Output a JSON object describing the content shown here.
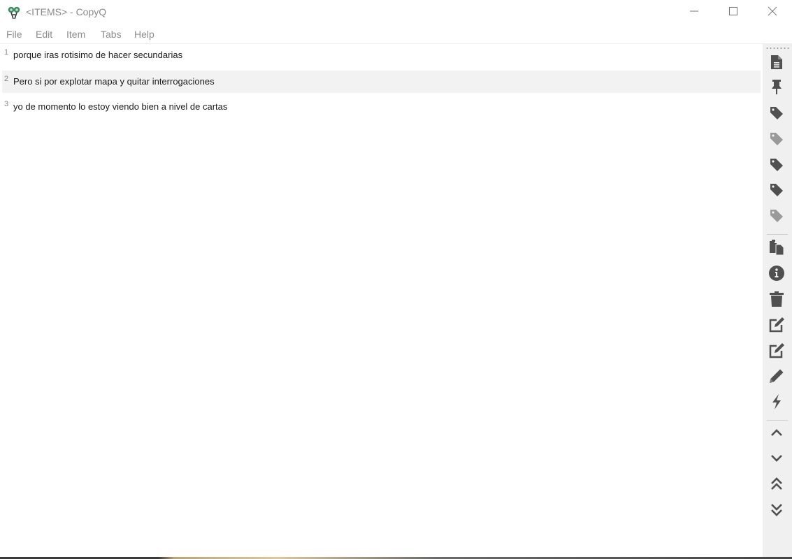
{
  "window": {
    "title": "<ITEMS> - CopyQ",
    "app_icon": "copyq-logo-icon",
    "controls": [
      "minimize-icon",
      "maximize-icon",
      "close-icon"
    ]
  },
  "menubar": {
    "items": [
      {
        "label": "File"
      },
      {
        "label": "Edit"
      },
      {
        "label": "Item"
      },
      {
        "label": "Tabs"
      },
      {
        "label": "Help"
      }
    ]
  },
  "items": [
    {
      "number": "1",
      "text": "porque iras rotisimo de hacer secundarias"
    },
    {
      "number": "2",
      "text": "Pero si por explotar mapa y quitar interrogaciones"
    },
    {
      "number": "3",
      "text": "yo de momento lo estoy viendo bien a nivel de cartas"
    }
  ],
  "toolbar": {
    "buttons": [
      {
        "icon": "new-item-icon",
        "group": 1
      },
      {
        "icon": "pin-icon",
        "group": 1
      },
      {
        "icon": "tag-icon",
        "group": 1
      },
      {
        "icon": "tag-light-icon",
        "group": 1
      },
      {
        "icon": "tag-icon",
        "group": 1
      },
      {
        "icon": "tag-icon",
        "group": 1
      },
      {
        "icon": "tag-light-icon",
        "group": 1
      },
      {
        "icon": "copy-icon",
        "group": 2
      },
      {
        "icon": "info-icon",
        "group": 2
      },
      {
        "icon": "trash-icon",
        "group": 2
      },
      {
        "icon": "edit-icon",
        "group": 2
      },
      {
        "icon": "edit-external-icon",
        "group": 2
      },
      {
        "icon": "pencil-icon",
        "group": 2
      },
      {
        "icon": "bolt-icon",
        "group": 2
      },
      {
        "icon": "chevron-up-icon",
        "group": 3
      },
      {
        "icon": "chevron-down-icon",
        "group": 3
      },
      {
        "icon": "double-chevron-up-icon",
        "group": 3
      },
      {
        "icon": "double-chevron-down-icon",
        "group": 3
      }
    ]
  },
  "colors": {
    "icon_dark": "#505050",
    "icon_light": "#9a9a9a",
    "selected_row": "#f2f2f2",
    "toolbar_bg": "#f0f0f0",
    "logo_green": "#3d8a5f"
  }
}
